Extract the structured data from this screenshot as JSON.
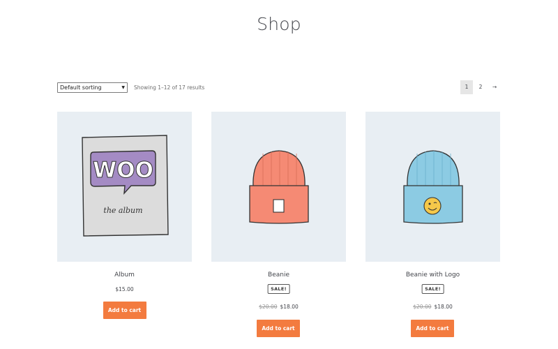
{
  "page": {
    "title": "Shop"
  },
  "toolbar": {
    "sort_selected": "Default sorting",
    "result_count": "Showing 1–12 of 17 results",
    "pagination": [
      "1",
      "2",
      "→"
    ]
  },
  "products": [
    {
      "name": "Album",
      "price": "$15.00",
      "add_to_cart": "Add to cart"
    },
    {
      "name": "Beanie",
      "sale_badge": "SALE!",
      "old_price": "$20.00",
      "price": "$18.00",
      "add_to_cart": "Add to cart"
    },
    {
      "name": "Beanie with Logo",
      "sale_badge": "SALE!",
      "old_price": "$20.00",
      "price": "$18.00",
      "add_to_cart": "Add to cart"
    }
  ],
  "artwork": {
    "album_logo": "WOO",
    "album_caption": "the album"
  },
  "colors": {
    "accent": "#f37b3f",
    "image_bg": "#e8eef3",
    "beanie_red": "#f58a74",
    "beanie_blue": "#8ccbe3",
    "album_purple": "#a48bc4"
  }
}
